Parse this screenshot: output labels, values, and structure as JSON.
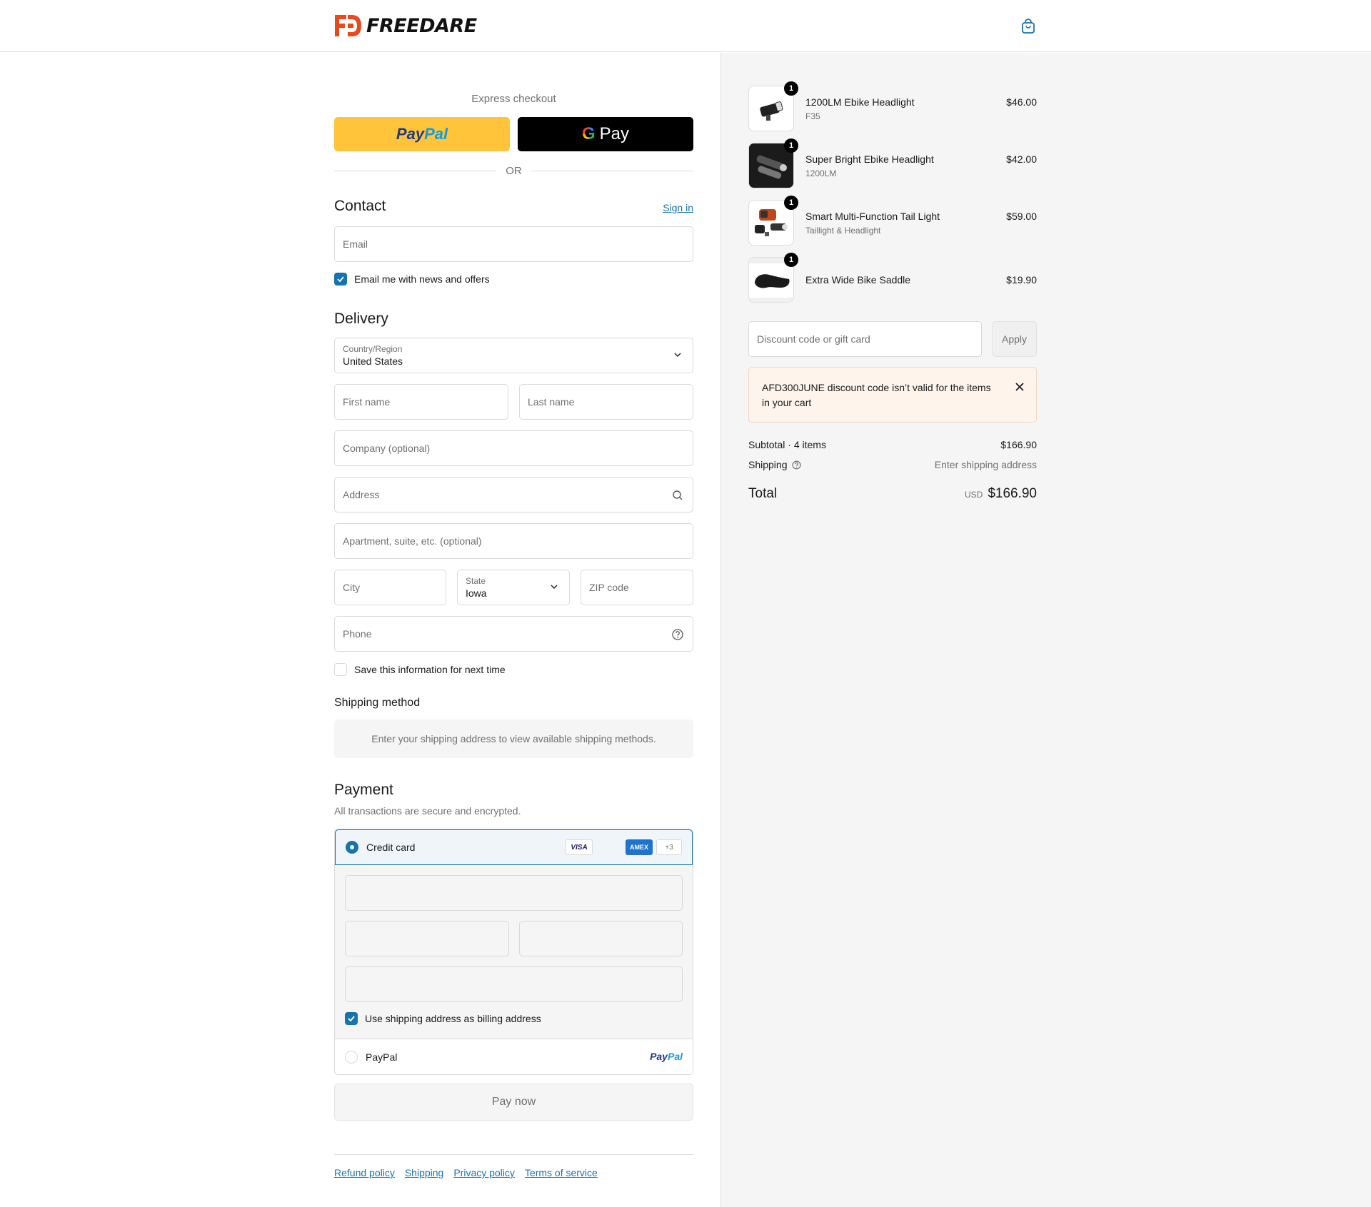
{
  "brand": {
    "name": "FREEDARE"
  },
  "express": {
    "title": "Express checkout",
    "paypal_part1": "Pay",
    "paypal_part2": "Pal",
    "gpay_g": "G",
    "gpay_text": "Pay",
    "or": "OR"
  },
  "contact": {
    "title": "Contact",
    "sign_in": "Sign in",
    "email_placeholder": "Email",
    "news_label": "Email me with news and offers",
    "news_checked": true
  },
  "delivery": {
    "title": "Delivery",
    "country_label": "Country/Region",
    "country_value": "United States",
    "first_name_placeholder": "First name",
    "last_name_placeholder": "Last name",
    "company_placeholder": "Company (optional)",
    "address_placeholder": "Address",
    "apartment_placeholder": "Apartment, suite, etc. (optional)",
    "city_placeholder": "City",
    "state_label": "State",
    "state_value": "Iowa",
    "zip_placeholder": "ZIP code",
    "phone_placeholder": "Phone",
    "save_label": "Save this information for next time"
  },
  "shipping_method": {
    "title": "Shipping method",
    "message": "Enter your shipping address to view available shipping methods."
  },
  "payment": {
    "title": "Payment",
    "subtitle": "All transactions are secure and encrypted.",
    "credit_card_label": "Credit card",
    "visa": "VISA",
    "amex": "AMEX",
    "more_cards": "+3",
    "billing_label": "Use shipping address as billing address",
    "paypal_label": "PayPal",
    "paypal_logo_part1": "Pay",
    "paypal_logo_part2": "Pal",
    "pay_now": "Pay now"
  },
  "footer": {
    "links": [
      "Refund policy",
      "Shipping",
      "Privacy policy",
      "Terms of service"
    ]
  },
  "cart": {
    "items": [
      {
        "name": "1200LM Ebike Headlight",
        "variant": "F35",
        "price": "$46.00",
        "qty": "1"
      },
      {
        "name": "Super Bright Ebike Headlight",
        "variant": "1200LM",
        "price": "$42.00",
        "qty": "1"
      },
      {
        "name": "Smart Multi-Function Tail Light",
        "variant": "Taillight & Headlight",
        "price": "$59.00",
        "qty": "1"
      },
      {
        "name": "Extra Wide Bike Saddle",
        "variant": "",
        "price": "$19.90",
        "qty": "1"
      }
    ],
    "discount_placeholder": "Discount code or gift card",
    "apply": "Apply",
    "alert": "AFD300JUNE discount code isn’t valid for the items in your cart",
    "subtotal_label": "Subtotal · 4 items",
    "subtotal_value": "$166.90",
    "shipping_label": "Shipping",
    "shipping_value": "Enter shipping address",
    "total_label": "Total",
    "currency": "USD",
    "total_value": "$166.90"
  },
  "colors": {
    "accent": "#1773b0",
    "paypal_yellow": "#ffc439",
    "brand_orange": "#e8491d"
  }
}
